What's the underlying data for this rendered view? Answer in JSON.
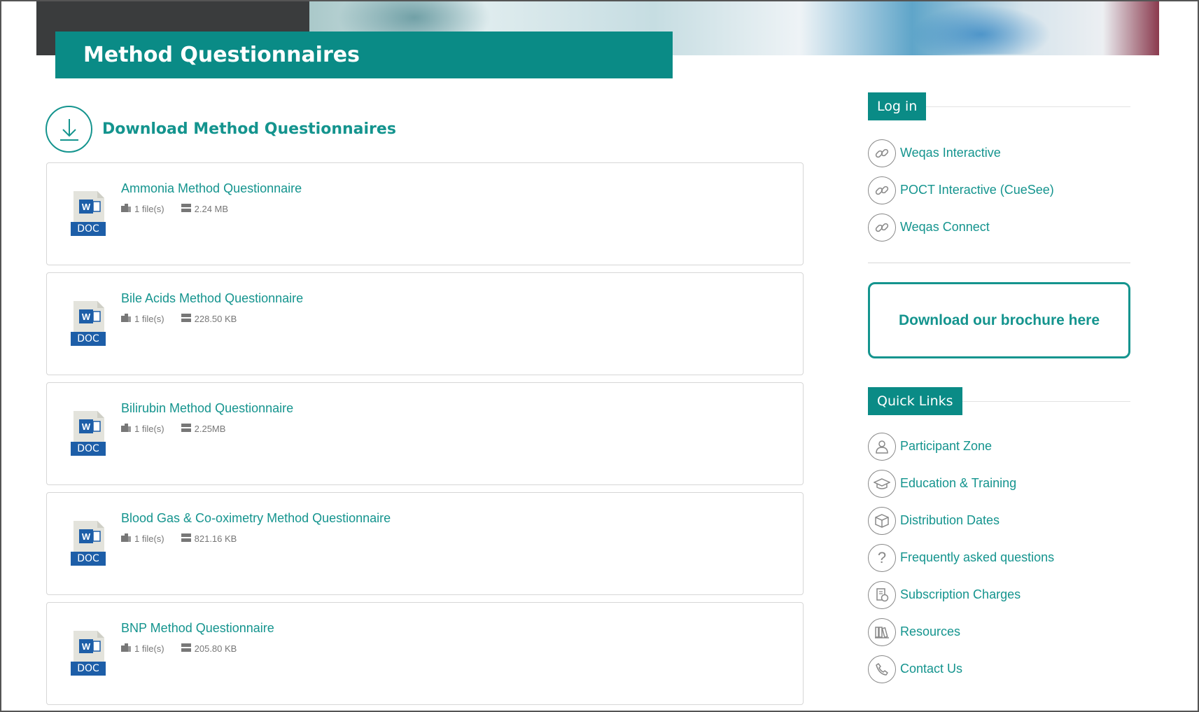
{
  "page": {
    "title": "Method Questionnaires"
  },
  "section": {
    "title": "Download Method Questionnaires",
    "icon": "download-icon"
  },
  "documents": [
    {
      "title": "Ammonia Method Questionnaire",
      "files": "1 file(s)",
      "size": "2.24 MB",
      "icon": "word-doc-icon",
      "badge": "DOC"
    },
    {
      "title": "Bile Acids Method Questionnaire",
      "files": "1 file(s)",
      "size": "228.50 KB",
      "icon": "word-doc-icon",
      "badge": "DOC"
    },
    {
      "title": "Bilirubin Method Questionnaire",
      "files": "1 file(s)",
      "size": "2.25MB",
      "icon": "word-doc-icon",
      "badge": "DOC"
    },
    {
      "title": "Blood Gas & Co-oximetry Method Questionnaire",
      "files": "1 file(s)",
      "size": "821.16 KB",
      "icon": "word-doc-icon",
      "badge": "DOC"
    },
    {
      "title": "BNP Method Questionnaire",
      "files": "1 file(s)",
      "size": "205.80 KB",
      "icon": "word-doc-icon",
      "badge": "DOC"
    }
  ],
  "login": {
    "heading": "Log in",
    "items": [
      {
        "label": "Weqas Interactive",
        "icon": "link-icon"
      },
      {
        "label": "POCT Interactive (CueSee)",
        "icon": "link-icon"
      },
      {
        "label": "Weqas Connect",
        "icon": "link-icon"
      }
    ]
  },
  "brochure": {
    "label": "Download our brochure here"
  },
  "quick_links": {
    "heading": "Quick Links",
    "items": [
      {
        "label": "Participant Zone",
        "icon": "user-icon"
      },
      {
        "label": "Education & Training",
        "icon": "graduation-cap-icon"
      },
      {
        "label": "Distribution Dates",
        "icon": "box-icon"
      },
      {
        "label": "Frequently asked questions",
        "icon": "question-icon"
      },
      {
        "label": "Subscription Charges",
        "icon": "receipt-icon"
      },
      {
        "label": "Resources",
        "icon": "books-icon"
      },
      {
        "label": "Contact Us",
        "icon": "phone-icon"
      }
    ]
  },
  "colors": {
    "brand": "#0a8b86",
    "link": "#14948e",
    "doc_blue": "#1d5ea8"
  }
}
